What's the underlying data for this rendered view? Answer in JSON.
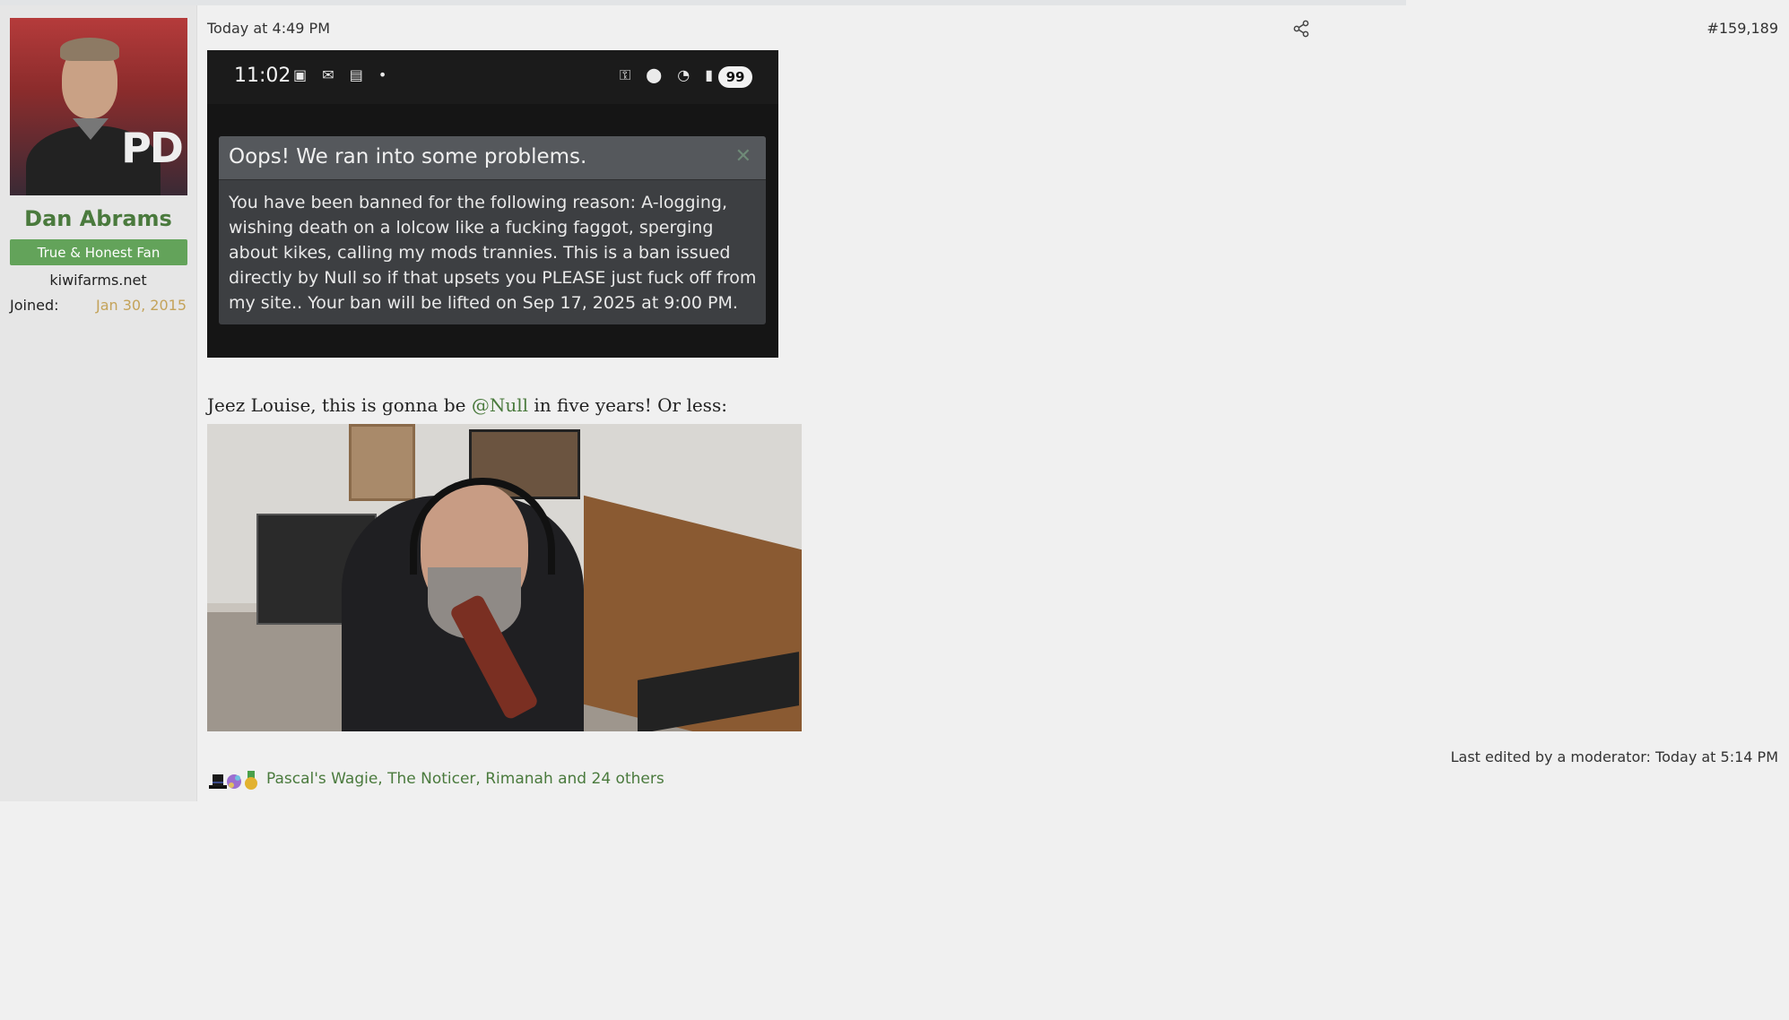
{
  "user": {
    "name": "Dan Abrams",
    "title": "True & Honest Fan",
    "banner": "kiwifarms.net",
    "joined_label": "Joined:",
    "joined_value": "Jan 30, 2015",
    "avatar_text": "PD"
  },
  "post": {
    "date": "Today at 4:49 PM",
    "number": "#159,189",
    "share_icon": "share-icon",
    "text_before": "Jeez Louise, this is gonna be ",
    "mention": "@Null",
    "text_after": " in five years! Or less:",
    "edited": "Last edited by a moderator: Today at 5:14 PM"
  },
  "screenshot": {
    "time": "11:02",
    "battery": "99",
    "error_title": "Oops! We ran into some problems.",
    "error_body": "You have been banned for the following reason: A-logging, wishing death on a lolcow like a fucking faggot, sperging about kikes, calling my mods trannies. This is a ban issued directly by Null so if that upsets you PLEASE just fuck off from my site.. Your ban will be lifted on Sep 17, 2025 at 9:00 PM."
  },
  "reactions": {
    "list": "Pascal's Wagie, The Noticer, Rimanah and 24 others",
    "icons": [
      "top-hat-icon",
      "puzzle-icon",
      "medal-icon"
    ]
  },
  "colors": {
    "accent_green": "#4a7a3d",
    "title_badge": "#63a35a",
    "joined_gold": "#c4a35a"
  }
}
